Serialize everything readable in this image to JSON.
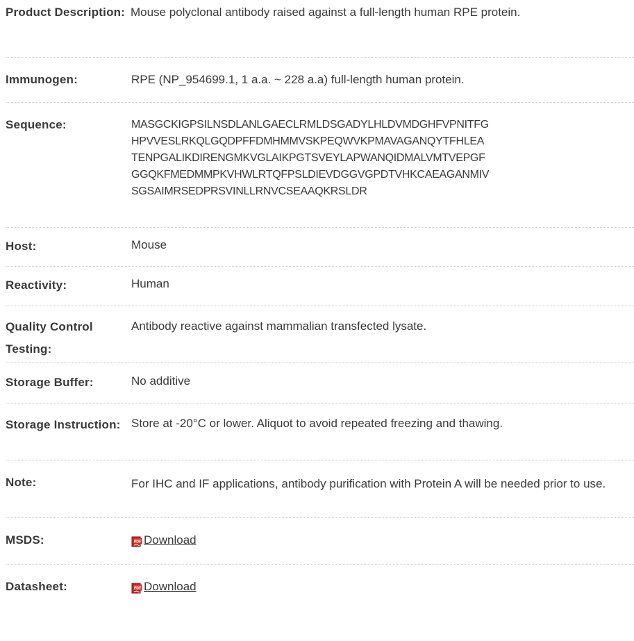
{
  "rows": [
    {
      "label": "Product Description:",
      "value": "Mouse polyclonal antibody raised against a full-length human RPE protein."
    },
    {
      "label": "Immunogen:",
      "value": "RPE (NP_954699.1, 1 a.a. ~ 228 a.a) full-length human protein."
    },
    {
      "label": "Sequence:",
      "value": "MASGCKIGPSILNSDLANLGAECLRMLDSGADYLHLDVMDGHFVPNITFG\nHPVVESLRKQLGQDPFFDMHMMVSKPEQWVKPMAVAGANQYTFHLEA\nTENPGALIKDIRENGMKVGLAIKPGTSVEYLAPWANQIDMALVMTVEPGF\nGGQKFMEDMMPKVHWLRTQFPSLDIEVDGGVGPDTVHKCAEAGANMIV\nSGSAIMRSEDPRSVINLLRNVCSEAAQKRSLDR"
    },
    {
      "label": "Host:",
      "value": "Mouse"
    },
    {
      "label": "Reactivity:",
      "value": "Human"
    },
    {
      "label": "Quality Control Testing:",
      "value": "Antibody reactive against mammalian transfected lysate."
    },
    {
      "label": "Storage Buffer:",
      "value": "No additive"
    },
    {
      "label": "Storage Instruction:",
      "value": "Store at -20°C or lower. Aliquot to avoid repeated freezing and thawing."
    },
    {
      "label": "Note:",
      "value": "For IHC and IF applications, antibody purification with Protein A will be needed prior to use."
    },
    {
      "label": "MSDS:",
      "link_text": "Download",
      "icon": "pdf-icon"
    },
    {
      "label": "Datasheet:",
      "link_text": "Download",
      "icon": "pdf-icon"
    }
  ],
  "colors": {
    "text": "#3a3a3a",
    "divider": "#c8c8c8",
    "pdf_icon_red": "#d42a2a"
  }
}
